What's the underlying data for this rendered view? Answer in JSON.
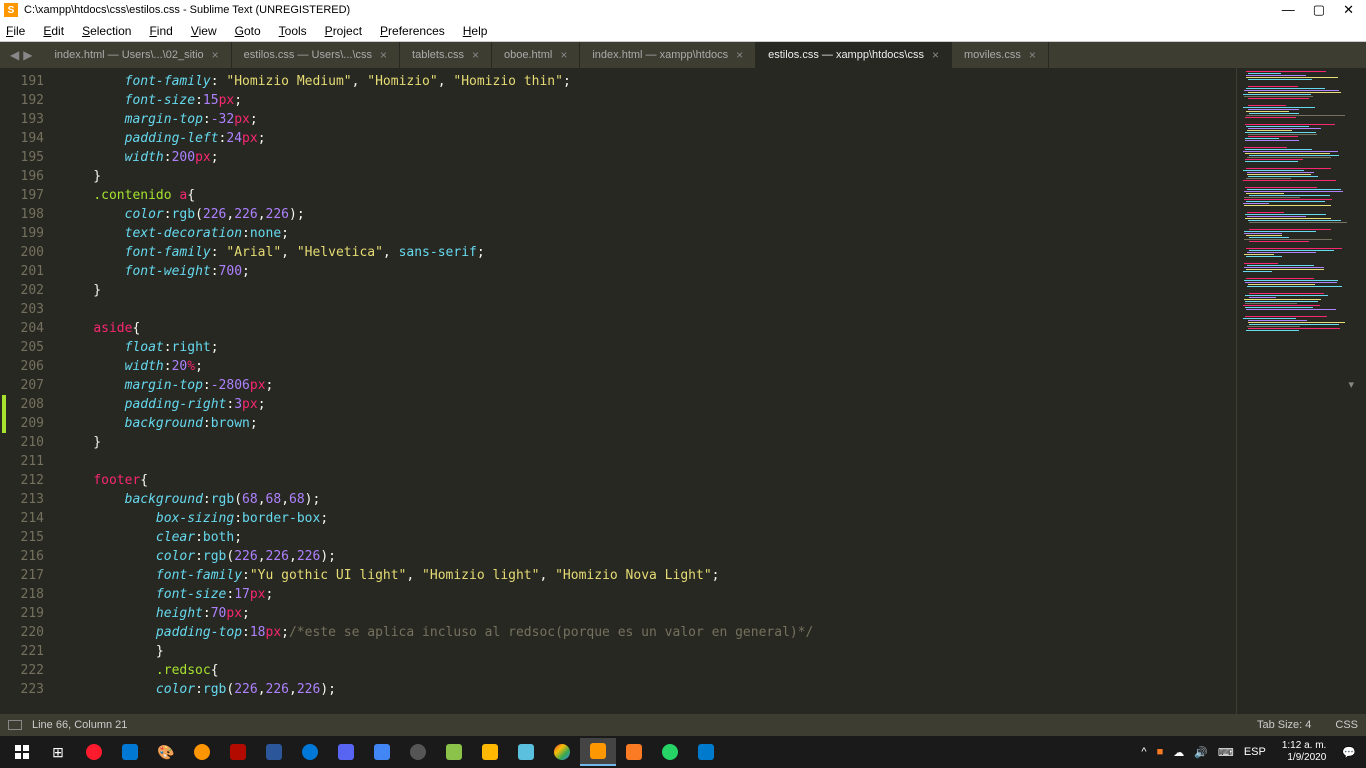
{
  "window": {
    "title": "C:\\xampp\\htdocs\\css\\estilos.css - Sublime Text (UNREGISTERED)"
  },
  "menu": [
    "File",
    "Edit",
    "Selection",
    "Find",
    "View",
    "Goto",
    "Tools",
    "Project",
    "Preferences",
    "Help"
  ],
  "tabs": [
    {
      "label": "index.html — Users\\...\\02_sitio",
      "active": false
    },
    {
      "label": "estilos.css — Users\\...\\css",
      "active": false
    },
    {
      "label": "tablets.css",
      "active": false
    },
    {
      "label": "oboe.html",
      "active": false
    },
    {
      "label": "index.html — xampp\\htdocs",
      "active": false
    },
    {
      "label": "estilos.css — xampp\\htdocs\\css",
      "active": true
    },
    {
      "label": "moviles.css",
      "active": false
    }
  ],
  "line_start": 191,
  "line_end": 223,
  "modified_lines": [
    208,
    209
  ],
  "code_lines": {
    "191": [
      [
        "        ",
        "punct"
      ],
      [
        "font-family",
        "prop"
      ],
      [
        ": ",
        "punct"
      ],
      [
        "\"Homizio Medium\"",
        "str"
      ],
      [
        ", ",
        "punct"
      ],
      [
        "\"Homizio\"",
        "str"
      ],
      [
        ", ",
        "punct"
      ],
      [
        "\"Homizio thin\"",
        "str"
      ],
      [
        ";",
        "punct"
      ]
    ],
    "192": [
      [
        "        ",
        "punct"
      ],
      [
        "font-size",
        "prop"
      ],
      [
        ":",
        "punct"
      ],
      [
        "15",
        "num"
      ],
      [
        "px",
        "unit"
      ],
      [
        ";",
        "punct"
      ]
    ],
    "193": [
      [
        "        ",
        "punct"
      ],
      [
        "margin-top",
        "prop"
      ],
      [
        ":",
        "punct"
      ],
      [
        "-32",
        "num"
      ],
      [
        "px",
        "unit"
      ],
      [
        ";",
        "punct"
      ]
    ],
    "194": [
      [
        "        ",
        "punct"
      ],
      [
        "padding-left",
        "prop"
      ],
      [
        ":",
        "punct"
      ],
      [
        "24",
        "num"
      ],
      [
        "px",
        "unit"
      ],
      [
        ";",
        "punct"
      ]
    ],
    "195": [
      [
        "        ",
        "punct"
      ],
      [
        "width",
        "prop"
      ],
      [
        ":",
        "punct"
      ],
      [
        "200",
        "num"
      ],
      [
        "px",
        "unit"
      ],
      [
        ";",
        "punct"
      ]
    ],
    "196": [
      [
        "    }",
        "punct"
      ]
    ],
    "197": [
      [
        "    ",
        "punct"
      ],
      [
        ".contenido",
        "class"
      ],
      [
        " ",
        "punct"
      ],
      [
        "a",
        "tag"
      ],
      [
        "{",
        "punct"
      ]
    ],
    "198": [
      [
        "        ",
        "punct"
      ],
      [
        "color",
        "prop"
      ],
      [
        ":",
        "punct"
      ],
      [
        "rgb",
        "func"
      ],
      [
        "(",
        "punct"
      ],
      [
        "226",
        "num"
      ],
      [
        ",",
        "punct"
      ],
      [
        "226",
        "num"
      ],
      [
        ",",
        "punct"
      ],
      [
        "226",
        "num"
      ],
      [
        ");",
        "punct"
      ]
    ],
    "199": [
      [
        "        ",
        "punct"
      ],
      [
        "text-decoration",
        "prop"
      ],
      [
        ":",
        "punct"
      ],
      [
        "none",
        "kw"
      ],
      [
        ";",
        "punct"
      ]
    ],
    "200": [
      [
        "        ",
        "punct"
      ],
      [
        "font-family",
        "prop"
      ],
      [
        ": ",
        "punct"
      ],
      [
        "\"Arial\"",
        "str"
      ],
      [
        ", ",
        "punct"
      ],
      [
        "\"Helvetica\"",
        "str"
      ],
      [
        ", ",
        "punct"
      ],
      [
        "sans-serif",
        "kw"
      ],
      [
        ";",
        "punct"
      ]
    ],
    "201": [
      [
        "        ",
        "punct"
      ],
      [
        "font-weight",
        "prop"
      ],
      [
        ":",
        "punct"
      ],
      [
        "700",
        "num"
      ],
      [
        ";",
        "punct"
      ]
    ],
    "202": [
      [
        "    }",
        "punct"
      ]
    ],
    "203": [
      [
        "",
        "punct"
      ]
    ],
    "204": [
      [
        "    ",
        "punct"
      ],
      [
        "aside",
        "tag"
      ],
      [
        "{",
        "punct"
      ]
    ],
    "205": [
      [
        "        ",
        "punct"
      ],
      [
        "float",
        "prop"
      ],
      [
        ":",
        "punct"
      ],
      [
        "right",
        "kw"
      ],
      [
        ";",
        "punct"
      ]
    ],
    "206": [
      [
        "        ",
        "punct"
      ],
      [
        "width",
        "prop"
      ],
      [
        ":",
        "punct"
      ],
      [
        "20",
        "num"
      ],
      [
        "%",
        "unit"
      ],
      [
        ";",
        "punct"
      ]
    ],
    "207": [
      [
        "        ",
        "punct"
      ],
      [
        "margin-top",
        "prop"
      ],
      [
        ":",
        "punct"
      ],
      [
        "-2806",
        "num"
      ],
      [
        "px",
        "unit"
      ],
      [
        ";",
        "punct"
      ]
    ],
    "208": [
      [
        "        ",
        "punct"
      ],
      [
        "padding-right",
        "prop"
      ],
      [
        ":",
        "punct"
      ],
      [
        "3",
        "num"
      ],
      [
        "px",
        "unit"
      ],
      [
        ";",
        "punct"
      ]
    ],
    "209": [
      [
        "        ",
        "punct"
      ],
      [
        "background",
        "prop"
      ],
      [
        ":",
        "punct"
      ],
      [
        "brown",
        "kw"
      ],
      [
        ";",
        "punct"
      ]
    ],
    "210": [
      [
        "    }",
        "punct"
      ]
    ],
    "211": [
      [
        "",
        "punct"
      ]
    ],
    "212": [
      [
        "    ",
        "punct"
      ],
      [
        "footer",
        "tag"
      ],
      [
        "{",
        "punct"
      ]
    ],
    "213": [
      [
        "        ",
        "punct"
      ],
      [
        "background",
        "prop"
      ],
      [
        ":",
        "punct"
      ],
      [
        "rgb",
        "func"
      ],
      [
        "(",
        "punct"
      ],
      [
        "68",
        "num"
      ],
      [
        ",",
        "punct"
      ],
      [
        "68",
        "num"
      ],
      [
        ",",
        "punct"
      ],
      [
        "68",
        "num"
      ],
      [
        ");",
        "punct"
      ]
    ],
    "214": [
      [
        "            ",
        "punct"
      ],
      [
        "box-sizing",
        "prop"
      ],
      [
        ":",
        "punct"
      ],
      [
        "border-box",
        "kw"
      ],
      [
        ";",
        "punct"
      ]
    ],
    "215": [
      [
        "            ",
        "punct"
      ],
      [
        "clear",
        "prop"
      ],
      [
        ":",
        "punct"
      ],
      [
        "both",
        "kw"
      ],
      [
        ";",
        "punct"
      ]
    ],
    "216": [
      [
        "            ",
        "punct"
      ],
      [
        "color",
        "prop"
      ],
      [
        ":",
        "punct"
      ],
      [
        "rgb",
        "func"
      ],
      [
        "(",
        "punct"
      ],
      [
        "226",
        "num"
      ],
      [
        ",",
        "punct"
      ],
      [
        "226",
        "num"
      ],
      [
        ",",
        "punct"
      ],
      [
        "226",
        "num"
      ],
      [
        ");",
        "punct"
      ]
    ],
    "217": [
      [
        "            ",
        "punct"
      ],
      [
        "font-family",
        "prop"
      ],
      [
        ":",
        "punct"
      ],
      [
        "\"Yu gothic UI light\"",
        "str"
      ],
      [
        ", ",
        "punct"
      ],
      [
        "\"Homizio light\"",
        "str"
      ],
      [
        ", ",
        "punct"
      ],
      [
        "\"Homizio Nova Light\"",
        "str"
      ],
      [
        ";",
        "punct"
      ]
    ],
    "218": [
      [
        "            ",
        "punct"
      ],
      [
        "font-size",
        "prop"
      ],
      [
        ":",
        "punct"
      ],
      [
        "17",
        "num"
      ],
      [
        "px",
        "unit"
      ],
      [
        ";",
        "punct"
      ]
    ],
    "219": [
      [
        "            ",
        "punct"
      ],
      [
        "height",
        "prop"
      ],
      [
        ":",
        "punct"
      ],
      [
        "70",
        "num"
      ],
      [
        "px",
        "unit"
      ],
      [
        ";",
        "punct"
      ]
    ],
    "220": [
      [
        "            ",
        "punct"
      ],
      [
        "padding-top",
        "prop"
      ],
      [
        ":",
        "punct"
      ],
      [
        "18",
        "num"
      ],
      [
        "px",
        "unit"
      ],
      [
        ";",
        "punct"
      ],
      [
        "/*este se aplica incluso al redsoc(porque es un valor en general)*/",
        "comment"
      ]
    ],
    "221": [
      [
        "            }",
        "punct"
      ]
    ],
    "222": [
      [
        "            ",
        "punct"
      ],
      [
        ".redsoc",
        "class"
      ],
      [
        "{",
        "punct"
      ]
    ],
    "223": [
      [
        "            ",
        "punct"
      ],
      [
        "color",
        "prop"
      ],
      [
        ":",
        "punct"
      ],
      [
        "rgb",
        "func"
      ],
      [
        "(",
        "punct"
      ],
      [
        "226",
        "num"
      ],
      [
        ",",
        "punct"
      ],
      [
        "226",
        "num"
      ],
      [
        ",",
        "punct"
      ],
      [
        "226",
        "num"
      ],
      [
        ");",
        "punct"
      ]
    ]
  },
  "status": {
    "left": "Line 66, Column 21",
    "tab": "Tab Size: 4",
    "lang": "CSS"
  },
  "tray": {
    "lang": "ESP",
    "time": "1:12 a. m.",
    "date": "1/9/2020"
  }
}
